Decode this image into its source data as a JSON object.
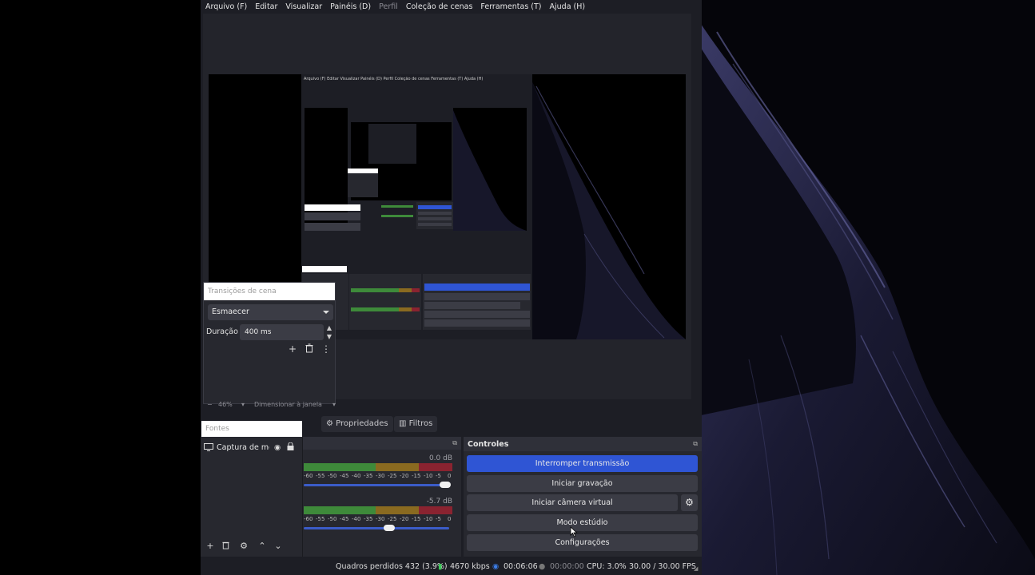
{
  "menu": [
    "Arquivo (F)",
    "Editar",
    "Visualizar",
    "Painéis (D)",
    "Perfil",
    "Coleção de cenas",
    "Ferramentas (T)",
    "Ajuda (H)"
  ],
  "transitions": {
    "title": "Transições de cena",
    "selected": "Esmaecer",
    "duration_label": "Duração",
    "duration_value": "400 ms"
  },
  "zoom": {
    "level": "46%",
    "mode": "Dimensionar à janela"
  },
  "tabs": {
    "fontes": "Fontes",
    "properties": "Propriedades",
    "filters": "Filtros"
  },
  "sources": {
    "items": [
      "Captura de moi"
    ]
  },
  "mixer": {
    "channels": [
      {
        "db": "0.0 dB",
        "volume": 0.97
      },
      {
        "db": "-5.7 dB",
        "volume": 0.59
      }
    ],
    "ticks": [
      "-60",
      "-55",
      "-50",
      "-45",
      "-40",
      "-35",
      "-30",
      "-25",
      "-20",
      "-15",
      "-10",
      "-5",
      "0"
    ]
  },
  "controls": {
    "title": "Controles",
    "stream": "Interromper transmissão",
    "record": "Iniciar gravação",
    "virtual_cam": "Iniciar câmera virtual",
    "studio": "Modo estúdio",
    "settings": "Configurações"
  },
  "status": {
    "dropped": "Quadros perdidos 432 (3.9%)",
    "bitrate": "4670 kbps",
    "stream_time": "00:06:06",
    "rec_time": "00:00:00",
    "cpu": "CPU: 3.0%",
    "fps": "30.00 / 30.00 FPS"
  },
  "colors": {
    "accent": "#2f55d4",
    "meter_green": "#3e8a3a",
    "meter_yellow": "#8a6a20",
    "meter_red": "#8a2330"
  }
}
